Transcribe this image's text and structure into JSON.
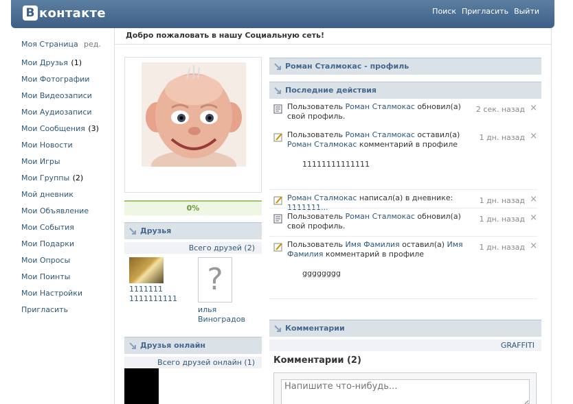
{
  "header": {
    "logo_letter": "В",
    "logo_text": "контакте",
    "nav": [
      "Поиск",
      "Пригласить",
      "Выйти"
    ]
  },
  "sidebar": {
    "edit": "ред.",
    "items": [
      {
        "label": "Моя Страница",
        "count": ""
      },
      {
        "label": "Мои Друзья",
        "count": "(1)"
      },
      {
        "label": "Мои Фотографии",
        "count": ""
      },
      {
        "label": "Мои Видеозаписи",
        "count": ""
      },
      {
        "label": "Мои Аудиозаписи",
        "count": ""
      },
      {
        "label": "Мои Сообщения",
        "count": "(3)"
      },
      {
        "label": "Мои Новости",
        "count": ""
      },
      {
        "label": "Мои Игры",
        "count": ""
      },
      {
        "label": "Мои Группы",
        "count": "(2)"
      },
      {
        "label": "Мой дневник",
        "count": ""
      },
      {
        "label": "Мои Объявление",
        "count": ""
      },
      {
        "label": "Мои События",
        "count": ""
      },
      {
        "label": "Мои Подарки",
        "count": ""
      },
      {
        "label": "Мои Опросы",
        "count": ""
      },
      {
        "label": "Мои Поинты",
        "count": ""
      },
      {
        "label": "Мои Настройки",
        "count": ""
      },
      {
        "label": "Пригласить",
        "count": ""
      }
    ]
  },
  "main": {
    "welcome": "Добро пожаловать в нашу Социальную сеть!"
  },
  "profile": {
    "rating": "0%"
  },
  "friends": {
    "title": "Друзья",
    "all": "Всего друзей (2)",
    "list": [
      {
        "name": "1111111 1111111111"
      },
      {
        "name": "илья Виноградов"
      }
    ]
  },
  "friends_online": {
    "title": "Друзья онлайн",
    "all": "Всего друзей онлайн (1)"
  },
  "profile_head": "Роман Сталмокас - профиль",
  "activity": {
    "title": "Последние действия",
    "items": [
      {
        "t1": "Пользователь ",
        "l1": "Роман Сталмокас",
        "t2": " обновил(а) свой профиль.",
        "time": "2 сек. назад"
      },
      {
        "t1": "Пользователь ",
        "l1": "Роман Сталмокас",
        "t2": " оставил(а) ",
        "l2": "Роман Сталмокас",
        "t3": " комментарий в профиле",
        "extra": "11111111111111",
        "time": "1 дн. назад"
      },
      {
        "l1": "Роман Сталмокас",
        "t2": " написал(а) в дневнике: ",
        "l2": "1111111...",
        "time": "1 дн. назад"
      },
      {
        "t1": "Пользователь ",
        "l1": "Роман Сталмокас",
        "t2": " обновил(а) свой профиль.",
        "time": "1 дн. назад"
      },
      {
        "t1": "Пользователь ",
        "l1": "Имя Фамилия",
        "t2": " оставил(а) ",
        "l2": "Имя Фамилия",
        "t3": " комментарий в профиле",
        "extra": "gggggggg",
        "time": "1 дн. назад"
      }
    ],
    "delete_icon": "×"
  },
  "comments": {
    "title": "Комментарии",
    "graffiti": "GRAFFITI",
    "heading": "Комментарии",
    "count": "(2)",
    "placeholder": "Напишите что-нибудь..."
  }
}
